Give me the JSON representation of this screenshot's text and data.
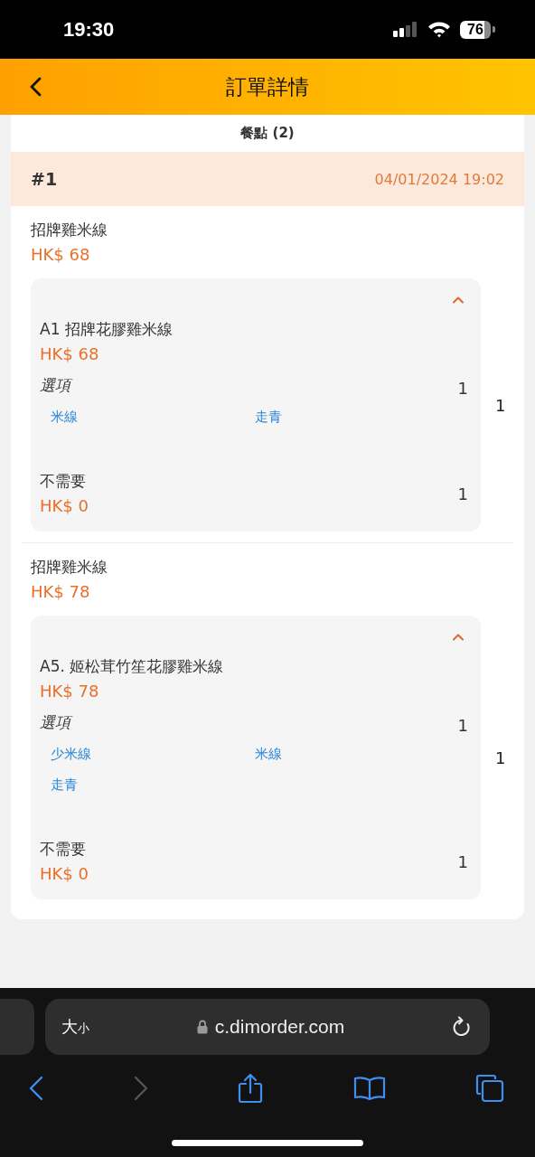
{
  "status_bar": {
    "time": "19:30",
    "battery": "76"
  },
  "header": {
    "title": "訂單詳情"
  },
  "section_title": "餐點 (2)",
  "order": {
    "number": "#1",
    "datetime": "04/01/2024 19:02"
  },
  "items": [
    {
      "name": "招牌雞米線",
      "price": "HK$ 68",
      "quantity": "1",
      "expanded": true,
      "detail": {
        "name": "A1 招牌花膠雞米線",
        "price": "HK$ 68",
        "group_label": "選項",
        "group_quantity": "1",
        "options": [
          "米線",
          "走青"
        ],
        "extras": [
          {
            "name": "不需要",
            "price": "HK$ 0",
            "quantity": "1"
          }
        ]
      }
    },
    {
      "name": "招牌雞米線",
      "price": "HK$ 78",
      "quantity": "1",
      "expanded": true,
      "detail": {
        "name": "A5. 姬松茸竹笙花膠雞米線",
        "price": "HK$ 78",
        "group_label": "選項",
        "group_quantity": "1",
        "options": [
          "少米線",
          "米線",
          "走青"
        ],
        "extras": [
          {
            "name": "不需要",
            "price": "HK$ 0",
            "quantity": "1"
          }
        ]
      }
    }
  ],
  "browser": {
    "text_size_large": "大",
    "text_size_small": "小",
    "url": "c.dimorder.com",
    "forward_disabled": true
  }
}
